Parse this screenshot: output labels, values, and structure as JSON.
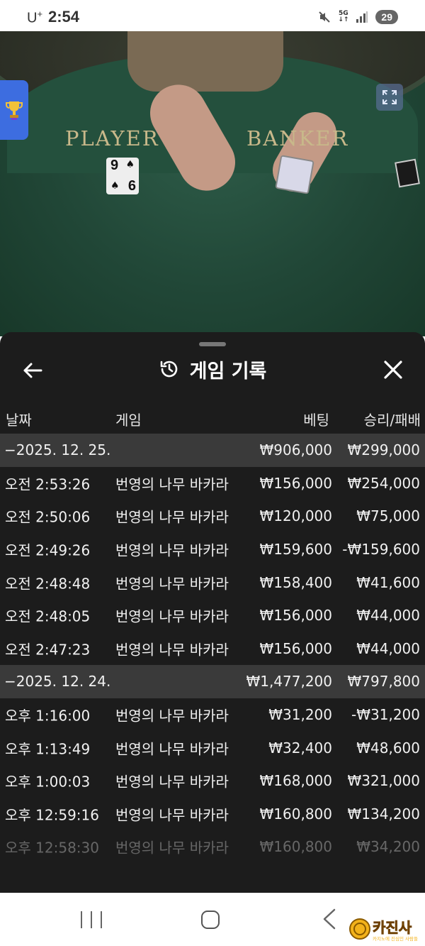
{
  "status_bar": {
    "carrier": "U",
    "carrier_sup": "+",
    "time": "2:54",
    "network": "5G",
    "battery": "29"
  },
  "video": {
    "player_label": "PLAYER",
    "banker_label": "BANKER",
    "player_card": {
      "rank_top": "9",
      "rank_bottom": "6",
      "suit": "♠"
    }
  },
  "history": {
    "title": "게임 기록",
    "columns": {
      "date": "날짜",
      "game": "게임",
      "bet": "베팅",
      "win_loss": "승리/패배"
    },
    "rows": [
      {
        "type": "group",
        "date": "−2025. 12. 25.",
        "game": "",
        "bet": "₩906,000",
        "win_loss": "₩299,000"
      },
      {
        "type": "item",
        "date": "오전 2:53:26",
        "game": "번영의 나무 바카라",
        "bet": "₩156,000",
        "win_loss": "₩254,000"
      },
      {
        "type": "item",
        "date": "오전 2:50:06",
        "game": "번영의 나무 바카라",
        "bet": "₩120,000",
        "win_loss": "₩75,000"
      },
      {
        "type": "item",
        "date": "오전 2:49:26",
        "game": "번영의 나무 바카라",
        "bet": "₩159,600",
        "win_loss": "-₩159,600"
      },
      {
        "type": "item",
        "date": "오전 2:48:48",
        "game": "번영의 나무 바카라",
        "bet": "₩158,400",
        "win_loss": "₩41,600"
      },
      {
        "type": "item",
        "date": "오전 2:48:05",
        "game": "번영의 나무 바카라",
        "bet": "₩156,000",
        "win_loss": "₩44,000"
      },
      {
        "type": "item",
        "date": "오전 2:47:23",
        "game": "번영의 나무 바카라",
        "bet": "₩156,000",
        "win_loss": "₩44,000"
      },
      {
        "type": "group",
        "date": "−2025. 12. 24.",
        "game": "",
        "bet": "₩1,477,200",
        "win_loss": "₩797,800"
      },
      {
        "type": "item",
        "date": "오후 1:16:00",
        "game": "번영의 나무 바카라",
        "bet": "₩31,200",
        "win_loss": "-₩31,200"
      },
      {
        "type": "item",
        "date": "오후 1:13:49",
        "game": "번영의 나무 바카라",
        "bet": "₩32,400",
        "win_loss": "₩48,600"
      },
      {
        "type": "item",
        "date": "오후 1:00:03",
        "game": "번영의 나무 바카라",
        "bet": "₩168,000",
        "win_loss": "₩321,000"
      },
      {
        "type": "item",
        "date": "오후 12:59:16",
        "game": "번영의 나무 바카라",
        "bet": "₩160,800",
        "win_loss": "₩134,200"
      },
      {
        "type": "item",
        "date": "오후 12:58:30",
        "game": "번영의 나무 바카라",
        "bet": "₩160,800",
        "win_loss": "₩34,200"
      }
    ]
  },
  "watermark": {
    "brand": "카진사",
    "tagline": "카지노에 진심인 사람들"
  },
  "colors": {
    "panel_bg": "#1c1c1c",
    "group_row_bg": "#3a3a3a",
    "felt_green": "#214737",
    "accent_blue": "#3d6de0",
    "gold": "#c8b88a"
  },
  "icons": {
    "back": "arrow-left-icon",
    "close": "close-x-icon",
    "title": "history-clock-icon",
    "expand": "fullscreen-icon",
    "trophy": "trophy-icon",
    "mute": "mute-icon",
    "signal": "signal-icon"
  }
}
